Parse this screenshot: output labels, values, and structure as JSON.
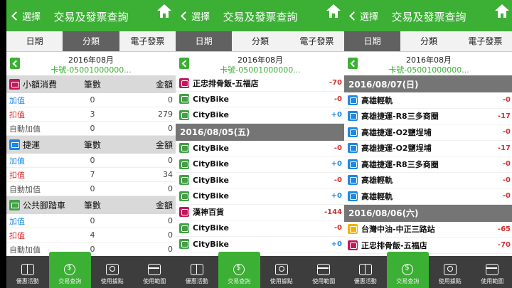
{
  "header": {
    "back_label": "選擇",
    "title": "交易及發票查詢"
  },
  "tabs": [
    "日期",
    "分類",
    "電子發票"
  ],
  "subheader": {
    "month": "2016年08月",
    "card": "卡號-05001000000..."
  },
  "nav": [
    "優惠活動",
    "交易查詢",
    "使用據點",
    "使用範圍"
  ],
  "colors": {
    "brand_green": "#3cb034",
    "amount_red": "#d32f2f",
    "amount_blue": "#1e88e5",
    "date_bar": "#757575"
  },
  "screen1": {
    "active_tab": 1,
    "col_count": "筆數",
    "col_amount": "金額",
    "categories": [
      {
        "name": "小額消費",
        "icon": "cart-icon",
        "rows": [
          {
            "label": "加值",
            "count": "0",
            "amount": "0"
          },
          {
            "label": "扣值",
            "count": "3",
            "amount": "279"
          },
          {
            "label": "自動加值",
            "count": "0",
            "amount": "0"
          }
        ]
      },
      {
        "name": "捷運",
        "icon": "metro-icon",
        "rows": [
          {
            "label": "加值",
            "count": "0",
            "amount": "0"
          },
          {
            "label": "扣值",
            "count": "7",
            "amount": "34"
          },
          {
            "label": "自動加值",
            "count": "0",
            "amount": "0"
          }
        ]
      },
      {
        "name": "公共腳踏車",
        "icon": "bike-icon",
        "rows": [
          {
            "label": "加值",
            "count": "0",
            "amount": "0"
          },
          {
            "label": "扣值",
            "count": "4",
            "amount": "0"
          },
          {
            "label": "自動加值",
            "count": "0",
            "amount": "0"
          }
        ]
      }
    ]
  },
  "screen2": {
    "active_tab": 0,
    "top_rows": [
      {
        "name": "正忠排骨飯-五福店",
        "amount": "-70",
        "icon": "cart-icon"
      },
      {
        "name": "CityBike",
        "amount": "-0",
        "icon": "bike-icon"
      },
      {
        "name": "CityBike",
        "amount": "+0",
        "icon": "bike-icon"
      }
    ],
    "date": "2016/08/05(五)",
    "rows": [
      {
        "name": "CityBike",
        "amount": "-0",
        "icon": "bike-icon"
      },
      {
        "name": "CityBike",
        "amount": "+0",
        "icon": "bike-icon"
      },
      {
        "name": "CityBike",
        "amount": "-0",
        "icon": "bike-icon"
      },
      {
        "name": "CityBike",
        "amount": "+0",
        "icon": "bike-icon"
      },
      {
        "name": "漢神百貨",
        "amount": "-144",
        "icon": "cart-icon"
      },
      {
        "name": "CityBike",
        "amount": "-0",
        "icon": "bike-icon"
      },
      {
        "name": "CityBike",
        "amount": "+0",
        "icon": "bike-icon"
      }
    ]
  },
  "screen3": {
    "active_tab": 0,
    "date1": "2016/08/07(日)",
    "rows1": [
      {
        "name": "高雄輕軌",
        "amount": "-0",
        "icon": "metro-icon"
      },
      {
        "name": "高雄捷運-R8三多商圈",
        "amount": "-17",
        "icon": "metro-icon"
      },
      {
        "name": "高雄捷運-O2鹽埕埔",
        "amount": "-0",
        "icon": "metro-icon"
      },
      {
        "name": "高雄捷運-O2鹽埕埔",
        "amount": "-17",
        "icon": "metro-icon"
      },
      {
        "name": "高雄捷運-R8三多商圈",
        "amount": "-0",
        "icon": "metro-icon"
      },
      {
        "name": "高雄輕軌",
        "amount": "-0",
        "icon": "metro-icon"
      },
      {
        "name": "高雄輕軌",
        "amount": "-0",
        "icon": "metro-icon"
      }
    ],
    "date2": "2016/08/06(六)",
    "rows2": [
      {
        "name": "台灣中油-中正三路站",
        "amount": "-65",
        "icon": "fuel-icon"
      },
      {
        "name": "正忠排骨飯-五福店",
        "amount": "-70",
        "icon": "cart-icon"
      }
    ]
  }
}
